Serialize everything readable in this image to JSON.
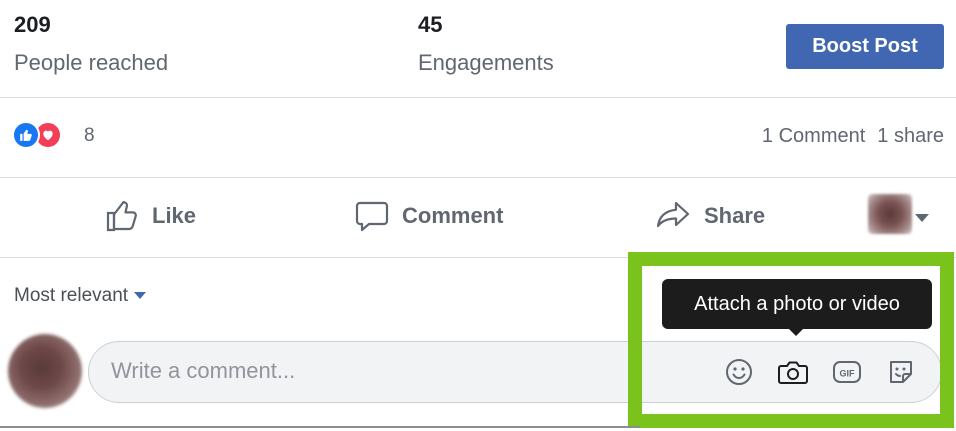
{
  "stats": {
    "reach_value": "209",
    "reach_label": "People reached",
    "engagements_value": "45",
    "engagements_label": "Engagements",
    "boost_label": "Boost Post"
  },
  "reactions": {
    "count": "8",
    "comments_text": "1 Comment",
    "shares_text": "1 share",
    "icons": [
      "like-icon",
      "love-icon"
    ],
    "like_color": "#1877f2",
    "love_color": "#f33e58"
  },
  "actions": {
    "like_label": "Like",
    "comment_label": "Comment",
    "share_label": "Share"
  },
  "comments": {
    "sort_label": "Most relevant",
    "placeholder": "Write a comment...",
    "tooltip": "Attach a photo or video",
    "input_icons": [
      "emoji-icon",
      "camera-icon",
      "gif-icon",
      "sticker-icon"
    ]
  },
  "colors": {
    "accent": "#4267b2",
    "highlight": "#7ac31c",
    "tooltip_bg": "#1c1c1c"
  }
}
